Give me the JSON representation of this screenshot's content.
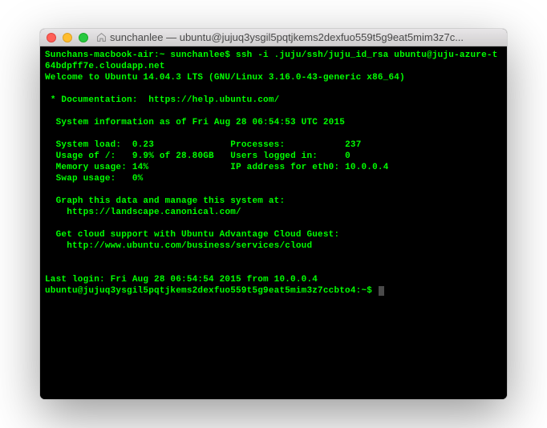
{
  "window": {
    "title": "sunchanlee — ubuntu@jujuq3ysgil5pqtjkems2dexfuo559t5g9eat5mim3z7c..."
  },
  "terminal": {
    "prompt1_host": "Sunchans-macbook-air:~ sunchanlee$ ",
    "prompt1_cmd": "ssh -i .juju/ssh/juju_id_rsa ubuntu@juju-azure-t64bdpff7e.cloudapp.net",
    "welcome": "Welcome to Ubuntu 14.04.3 LTS (GNU/Linux 3.16.0-43-generic x86_64)",
    "doc_label": " * Documentation:  ",
    "doc_url": "https://help.ubuntu.com/",
    "sysinfo_header": "  System information as of Fri Aug 28 06:54:53 UTC 2015",
    "row1_left_label": "  System load:  ",
    "row1_left_val": "0.23",
    "row1_right_label": "Processes:           ",
    "row1_right_val": "237",
    "row2_left_label": "  Usage of /:   ",
    "row2_left_val": "9.9% of 28.80GB",
    "row2_right_label": "Users logged in:     ",
    "row2_right_val": "0",
    "row3_left_label": "  Memory usage: ",
    "row3_left_val": "14%",
    "row3_right_label": "IP address for eth0: ",
    "row3_right_val": "10.0.0.4",
    "row4_left_label": "  Swap usage:   ",
    "row4_left_val": "0%",
    "graph_line": "  Graph this data and manage this system at:",
    "graph_url": "    https://landscape.canonical.com/",
    "cloud_line": "  Get cloud support with Ubuntu Advantage Cloud Guest:",
    "cloud_url": "    http://www.ubuntu.com/business/services/cloud",
    "last_login": "Last login: Fri Aug 28 06:54:54 2015 from 10.0.0.4",
    "prompt2": "ubuntu@jujuq3ysgil5pqtjkems2dexfuo559t5g9eat5mim3z7ccbto4:~$ "
  }
}
